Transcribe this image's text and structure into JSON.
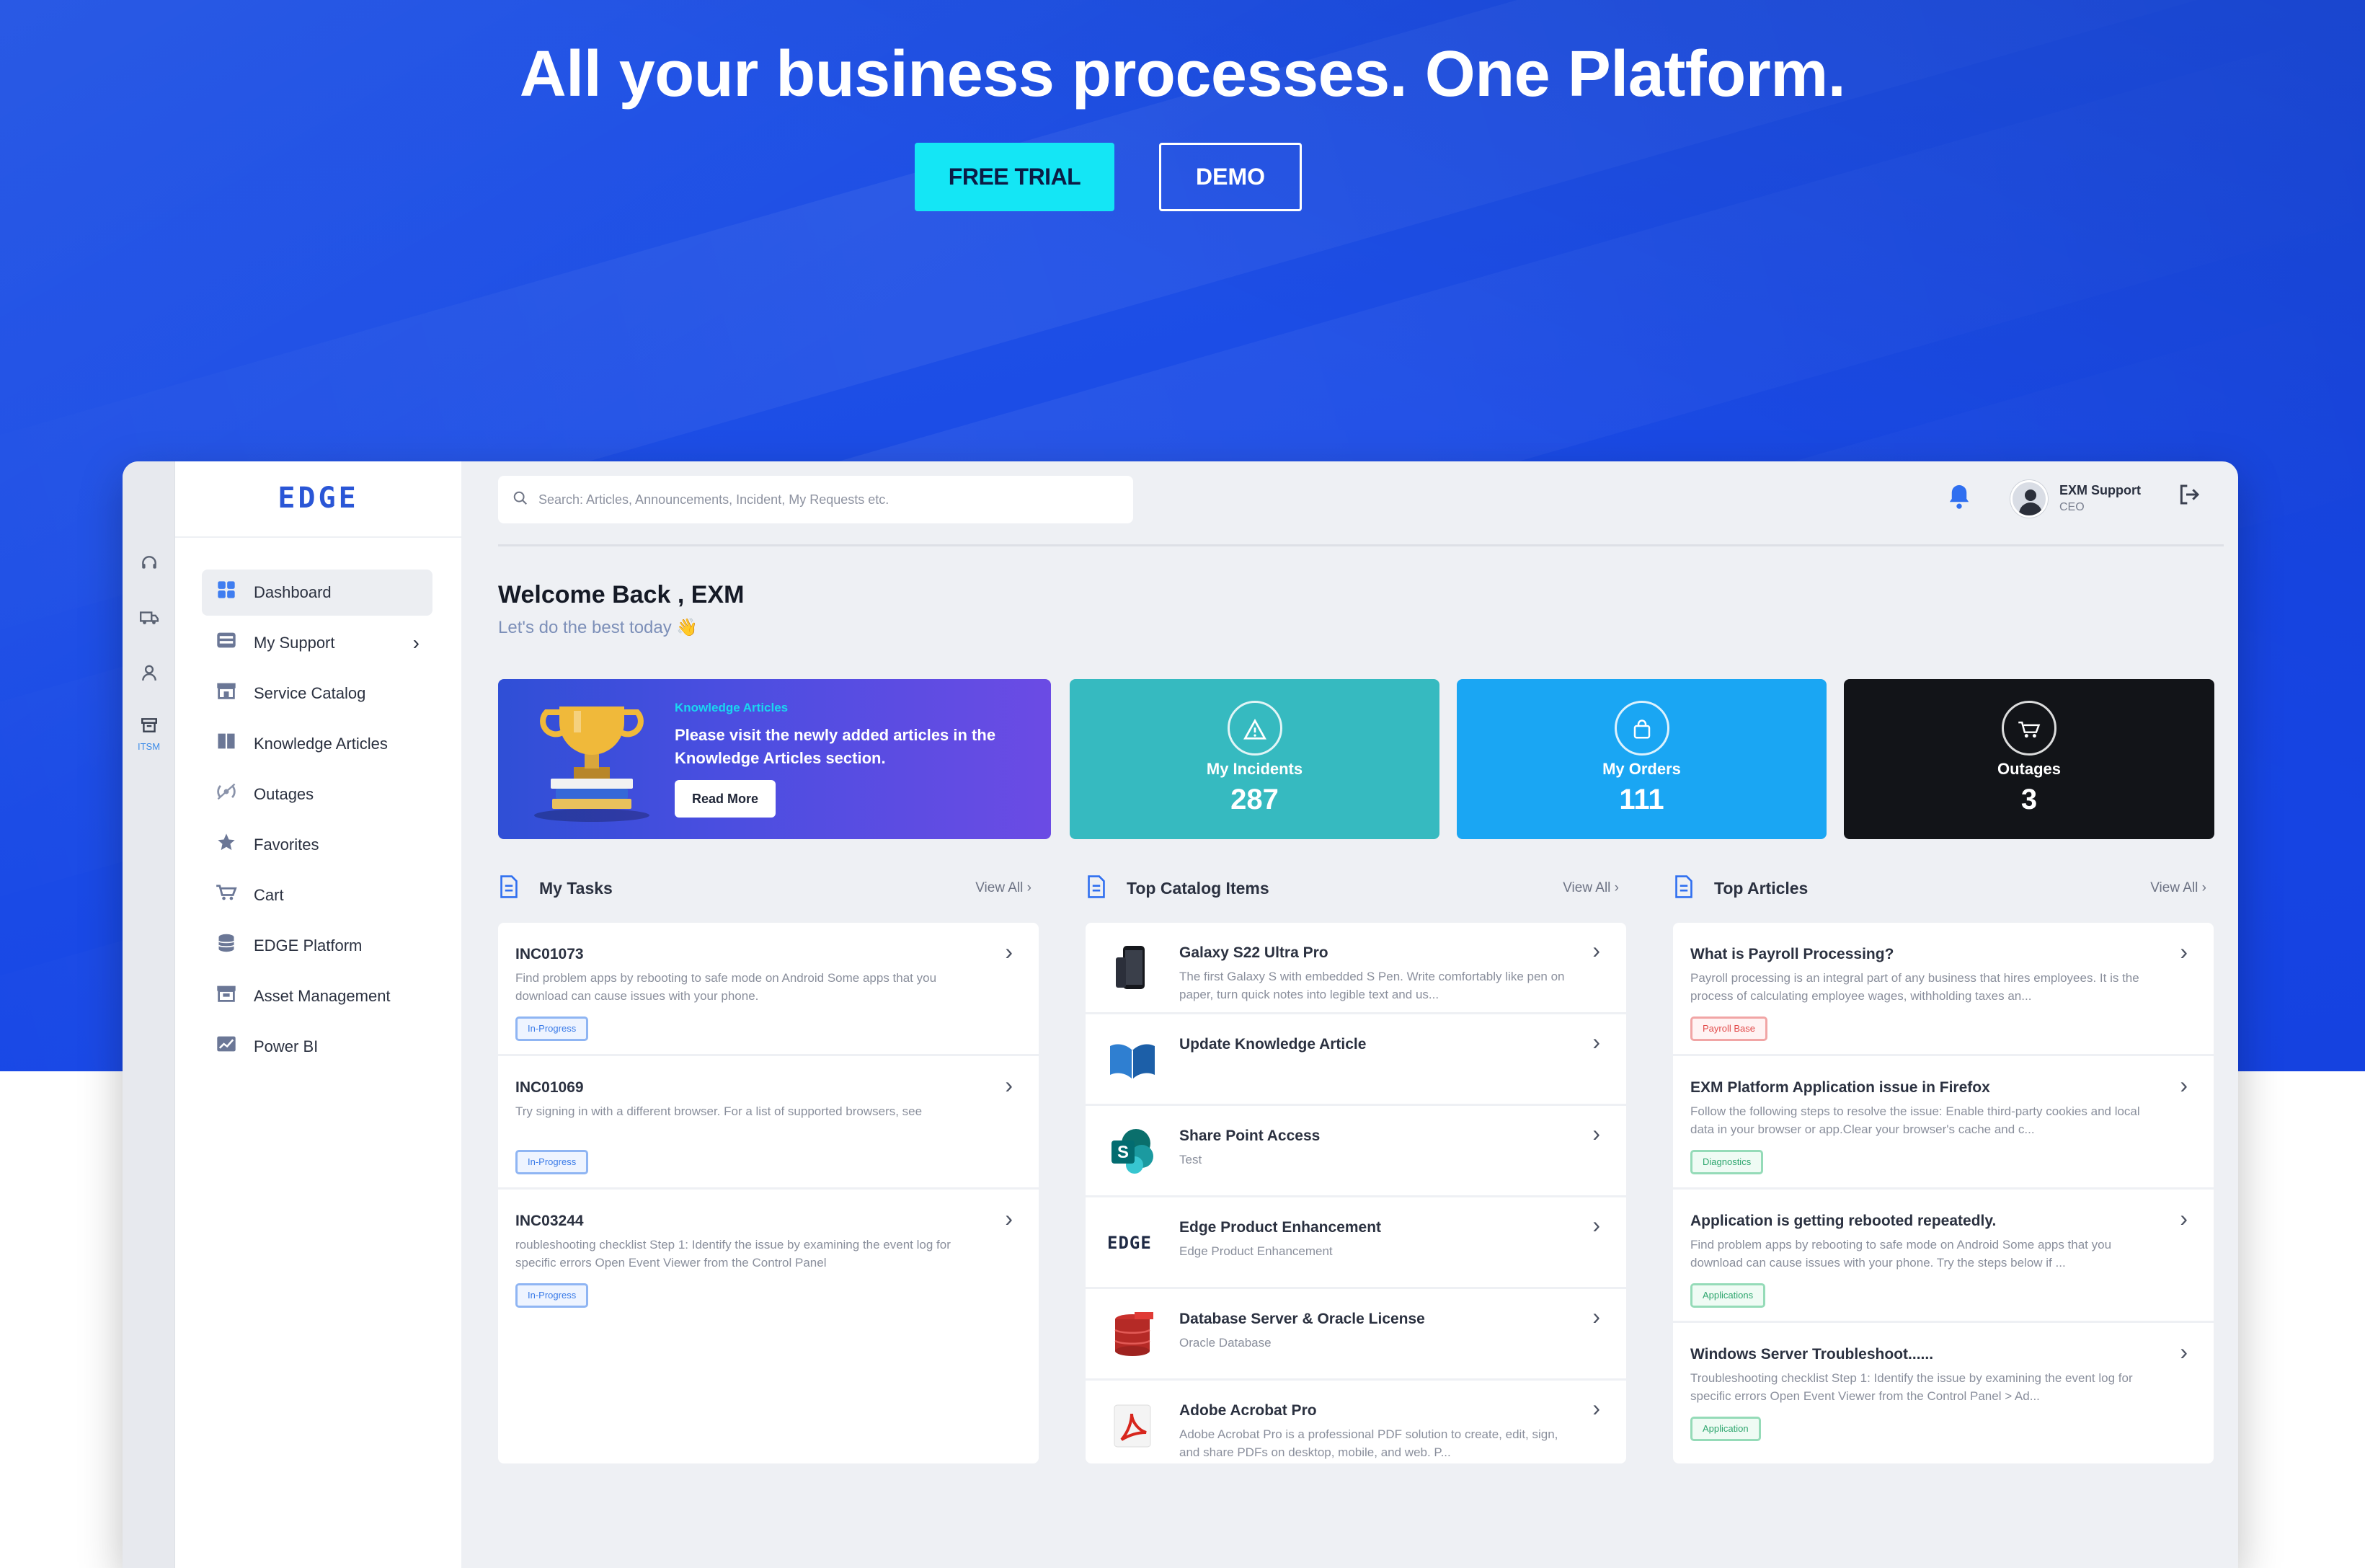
{
  "hero": {
    "title": "All your business processes. One Platform.",
    "free_trial": "FREE TRIAL",
    "demo": "DEMO"
  },
  "colors": {
    "hero_bg": "#1d4ee6",
    "trial_button": "#14e6f5",
    "incidents_card": "#36bac0",
    "orders_card": "#1aa6f3",
    "outages_card": "#121418",
    "accent": "#2f6ff0"
  },
  "rail": {
    "items": [
      {
        "icon": "headset-icon"
      },
      {
        "icon": "truck-icon"
      },
      {
        "icon": "user-icon"
      },
      {
        "icon": "archive-icon",
        "label": "ITSM"
      }
    ]
  },
  "sidebar": {
    "logo": "EDGE",
    "items": [
      {
        "label": "Dashboard",
        "icon": "grid-icon",
        "active": true
      },
      {
        "label": "My Support",
        "icon": "inbox-icon",
        "has_submenu": true
      },
      {
        "label": "Service Catalog",
        "icon": "store-icon"
      },
      {
        "label": "Knowledge Articles",
        "icon": "book-icon"
      },
      {
        "label": "Outages",
        "icon": "signal-icon"
      },
      {
        "label": "Favorites",
        "icon": "star-icon"
      },
      {
        "label": "Cart",
        "icon": "cart-icon"
      },
      {
        "label": "EDGE Platform",
        "icon": "database-icon"
      },
      {
        "label": "Asset Management",
        "icon": "asset-icon"
      },
      {
        "label": "Power BI",
        "icon": "chart-icon"
      }
    ]
  },
  "header": {
    "search_placeholder": "Search: Articles, Announcements, Incident, My Requests etc.",
    "user_name": "EXM Support",
    "user_role": "CEO"
  },
  "welcome": {
    "title": "Welcome Back , EXM",
    "subtitle": "Let's do the best today 👋"
  },
  "banner": {
    "tag": "Knowledge Articles",
    "text": "Please visit the newly added articles in the Knowledge Articles section.",
    "button": "Read More"
  },
  "stats": {
    "incidents": {
      "label": "My Incidents",
      "value": "287",
      "icon": "warning-icon"
    },
    "orders": {
      "label": "My Orders",
      "value": "111",
      "icon": "bag-icon"
    },
    "outages": {
      "label": "Outages",
      "value": "3",
      "icon": "cart-icon"
    }
  },
  "view_all": "View All",
  "tasks": {
    "title": "My Tasks",
    "items": [
      {
        "id": "INC01073",
        "desc": "Find problem apps by rebooting to safe mode on Android Some apps that you download can cause issues with your phone.",
        "status": "In-Progress"
      },
      {
        "id": "INC01069",
        "desc": "Try signing in with a different browser. For a list of supported browsers, see",
        "status": "In-Progress"
      },
      {
        "id": "INC03244",
        "desc": "roubleshooting checklist Step 1: Identify the issue by examining the event log for specific errors Open Event Viewer from the Control Panel",
        "status": "In-Progress"
      }
    ]
  },
  "catalog": {
    "title": "Top Catalog Items",
    "items": [
      {
        "name": "Galaxy S22 Ultra Pro",
        "desc": "The first Galaxy S with embedded S Pen. Write comfortably like pen on paper, turn quick notes into legible text and us...",
        "icon": "phone-icon"
      },
      {
        "name": "Update Knowledge Article",
        "desc": "",
        "icon": "open-book-icon"
      },
      {
        "name": "Share Point Access",
        "desc": "Test",
        "icon": "sharepoint-icon"
      },
      {
        "name": "Edge Product Enhancement",
        "desc": "Edge Product Enhancement",
        "icon": "edge-logo-icon",
        "logo_text": "EDGE"
      },
      {
        "name": "Database Server & Oracle License",
        "desc": "Oracle Database",
        "icon": "oracle-db-icon"
      },
      {
        "name": "Adobe Acrobat Pro",
        "desc": "Adobe Acrobat Pro is a professional PDF solution to create, edit, sign, and share PDFs on desktop, mobile, and web. P...",
        "icon": "acrobat-icon"
      }
    ]
  },
  "articles": {
    "title": "Top Articles",
    "items": [
      {
        "title": "What is Payroll Processing?",
        "desc": "Payroll processing is an integral part of any business that hires employees. It is the process of calculating employee wages, withholding taxes an...",
        "tag": "Payroll Base",
        "tag_color": "red"
      },
      {
        "title": "EXM Platform Application issue in Firefox",
        "desc": "Follow the following steps to resolve the issue: Enable third-party cookies and local data in your browser or app.Clear your browser's cache and c...",
        "tag": "Diagnostics",
        "tag_color": "green"
      },
      {
        "title": "Application is getting rebooted repeatedly.",
        "desc": "Find problem apps by rebooting to safe mode on Android Some apps that you download can cause issues with your phone. Try the steps below if ...",
        "tag": "Applications",
        "tag_color": "green"
      },
      {
        "title": "Windows Server Troubleshoot......",
        "desc": "Troubleshooting checklist Step 1: Identify the issue by examining the event log for specific errors Open Event Viewer from the Control Panel > Ad...",
        "tag": "Application",
        "tag_color": "green"
      }
    ]
  }
}
